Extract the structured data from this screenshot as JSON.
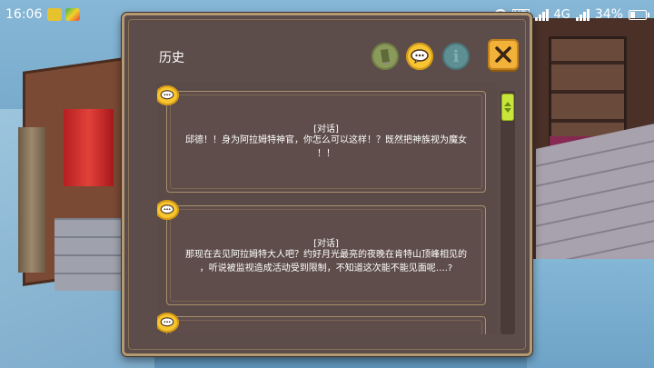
{
  "status_bar": {
    "time": "16:06",
    "app_icons": [
      "app-notification-icon",
      "app-notification-icon"
    ],
    "icons": [
      "headset-icon",
      "hd-icon",
      "signal-icon",
      "network-4g-icon",
      "battery-icon"
    ],
    "hd_label": "HD",
    "network_label": "4G",
    "battery_percent": "34%",
    "battery_level": 0.34
  },
  "history_panel": {
    "title": "历史",
    "filters": [
      {
        "name": "filter-all",
        "icon": "scroll-icon",
        "color": "#8a9a5a"
      },
      {
        "name": "filter-dialogue",
        "icon": "speech-bubble-icon",
        "color": "#f6c531"
      },
      {
        "name": "filter-info",
        "icon": "info-icon",
        "color": "#5d8f93",
        "glyph": "i"
      }
    ],
    "close_icon": "close-icon",
    "accent_color": "#f2b23a",
    "entries": [
      {
        "icon": "speech-bubble-icon",
        "speaker": "[对话]",
        "lines": [
          "邱德！！身为阿拉姆特神官，你怎么可以这样！？既然把神族视为魔女",
          "！！"
        ]
      },
      {
        "icon": "speech-bubble-icon",
        "speaker": "[对话]",
        "lines": [
          "那现在去见阿拉姆特大人吧？约好月光最亮的夜晚在肯特山顶峰相见的",
          "，听说被监视造成活动受到限制，不知道这次能不能见面呢….?"
        ]
      },
      {
        "icon": "speech-bubble-icon",
        "speaker": "",
        "lines": []
      }
    ]
  }
}
